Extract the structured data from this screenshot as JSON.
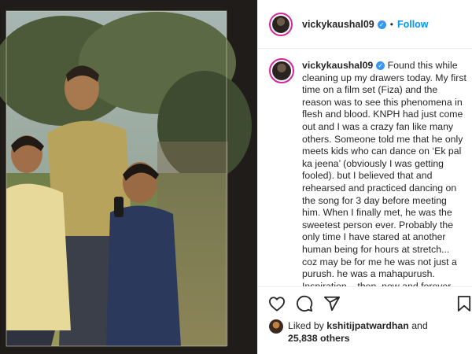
{
  "post": {
    "username": "vickykaushal09",
    "separator": "•",
    "follow_label": "Follow",
    "caption": "Found this while cleaning up my drawers today. My first time on a film set (Fiza) and the reason was to see this phenomena in flesh and blood. KNPH had just come out and I was a crazy fan like many others. Someone told me that he only meets kids who can dance on ‘Ek pal ka jeena’ (obviously I was getting fooled). but I believed that and rehearsed and practiced dancing on the song for 3 day before meeting him. When I finally met, he was the sweetest person ever. Probably the only time I have stared at another human being for hours at stretch... coz may be for me he was not just a purush. he was a mahapurush. Inspiration... then, now and forever."
  },
  "likes": {
    "prefix": "Liked by",
    "user": "kshitijpatwardhan",
    "and": "and",
    "count": "25,838 others"
  },
  "icons": {
    "like": "heart-icon",
    "comment": "comment-icon",
    "share": "share-icon",
    "save": "bookmark-icon",
    "verified": "verified-badge-icon"
  },
  "colors": {
    "accent": "#0095f6",
    "verified": "#3897f0",
    "text": "#262626",
    "story_ring": "#d6249f"
  }
}
